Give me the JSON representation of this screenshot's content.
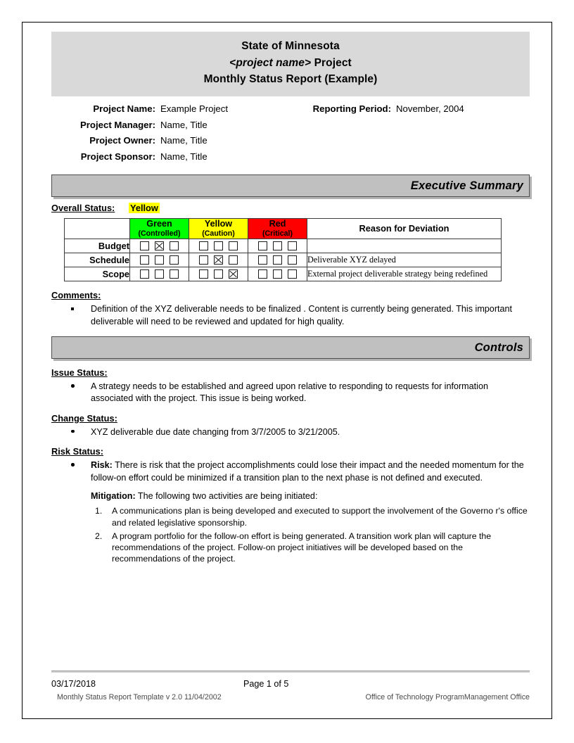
{
  "document": {
    "title_lines": [
      {
        "text": "State of Minnesota",
        "italic_prefix": ""
      },
      {
        "text": "Project",
        "italic_prefix": "<project name>"
      },
      {
        "text": "Monthly Status Report (Example)",
        "italic_prefix": ""
      }
    ],
    "header": {
      "line1": "State of Minnesota",
      "line2_italic": "<project name>",
      "line2_rest": " Project",
      "line3": "Monthly Status Report (Example)"
    }
  },
  "project_info": {
    "project_name_label": "Project Name:",
    "project_name_value": "Example Project",
    "reporting_period_label": "Reporting Period:",
    "reporting_period_value": "November, 2004",
    "project_manager_label": "Project Manager:",
    "project_manager_value": "Name, Title",
    "project_owner_label": "Project Owner:",
    "project_owner_value": "Name, Title",
    "project_sponsor_label": "Project Sponsor:",
    "project_sponsor_value": "Name, Title"
  },
  "sections": {
    "executive_summary_banner": "Executive Summary",
    "controls_banner": "Controls"
  },
  "overall_status": {
    "label": "Overall Status:",
    "value": "Yellow",
    "highlight_color": "#ffff00"
  },
  "status_table": {
    "headers": {
      "blank": "",
      "green_name": "Green",
      "green_sub": "(Controlled)",
      "yellow_name": "Yellow",
      "yellow_sub": "(Caution)",
      "red_name": "Red",
      "red_sub": "(Critical)",
      "reason": "Reason for Deviation"
    },
    "colors": {
      "green": "#00ff00",
      "yellow": "#ffff00",
      "red": "#ff0000"
    },
    "rows": [
      {
        "label": "Budget",
        "green": [
          false,
          true,
          false
        ],
        "yellow": [
          false,
          false,
          false
        ],
        "red": [
          false,
          false,
          false
        ],
        "reason": ""
      },
      {
        "label": "Schedule",
        "green": [
          false,
          false,
          false
        ],
        "yellow": [
          false,
          true,
          false
        ],
        "red": [
          false,
          false,
          false
        ],
        "reason": "Deliverable  XYZ delayed"
      },
      {
        "label": "Scope",
        "green": [
          false,
          false,
          false
        ],
        "yellow": [
          false,
          false,
          true
        ],
        "red": [
          false,
          false,
          false
        ],
        "reason": "External project deliverable strategy being redefined"
      }
    ]
  },
  "comments": {
    "heading": "Comments:",
    "items": [
      "Definition of the  XYZ  deliverable  needs to be finalized .  Content is currently being generated.  This important deliverable will need to be reviewed and updated for high quality."
    ]
  },
  "issue_status": {
    "heading": "Issue Status:",
    "items": [
      "A strategy needs to be established  and agreed upon relative to   responding to  requests for information associated with the project.  This issue is being worked."
    ]
  },
  "change_status": {
    "heading": "Change Status:",
    "items": [
      "XYZ  deliverable due date changing from    3/7/2005 to 3/21/2005."
    ]
  },
  "risk_status": {
    "heading": "Risk Status:",
    "risk_label": "Risk:",
    "risk_text": " There is risk that the  project accomplishments could lose their impact and the needed momentum for the follow-on effort could be   minimized if a transition plan to the next phase is not defined and executed.",
    "mitigation_label": "Mitigation:",
    "mitigation_text": "  The following two activities are being initiated:",
    "mitigation_items": [
      "A communications plan is being developed and executed to support the involvement of the Governo r's office and related legislative sponsorship.",
      "A program portfolio for the follow-on effort is being generated. A transition work plan will capture the recommendations of the project. Follow-on project initiatives will be developed based on the recommendations of the project."
    ]
  },
  "footer": {
    "date": "03/17/2018",
    "page": "Page 1 of 5",
    "template": "Monthly Status Report Template  v 2.0  11/04/2002",
    "office": "Office of Technology ProgramManagement Office"
  }
}
